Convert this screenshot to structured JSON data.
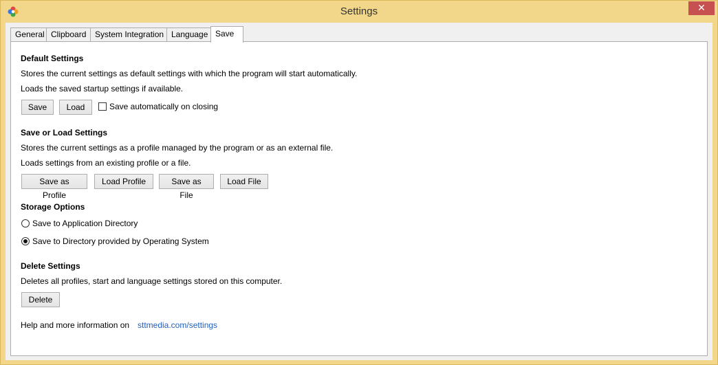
{
  "window": {
    "title": "Settings",
    "close_glyph": "✕"
  },
  "tabs": [
    {
      "label": "General"
    },
    {
      "label": "Clipboard"
    },
    {
      "label": "System Integration"
    },
    {
      "label": "Language"
    },
    {
      "label": "Save",
      "active": true
    }
  ],
  "default_settings": {
    "heading": "Default Settings",
    "line1": "Stores the current settings as default settings with which the program will start automatically.",
    "line2": "Loads the saved startup settings if available.",
    "save_label": "Save",
    "load_label": "Load",
    "auto_save_label": "Save automatically on closing",
    "auto_save_checked": false
  },
  "save_load": {
    "heading": "Save or Load Settings",
    "line1": "Stores the current settings as a profile managed by the program or as an external file.",
    "line2": "Loads settings from an existing profile or a file.",
    "save_profile_label": "Save as Profile",
    "load_profile_label": "Load Profile",
    "save_file_label": "Save as File",
    "load_file_label": "Load File"
  },
  "storage": {
    "heading": "Storage Options",
    "option1": "Save to Application Directory",
    "option2": "Save to Directory provided by Operating System",
    "selected": "option2"
  },
  "delete_settings": {
    "heading": "Delete Settings",
    "line1": "Deletes all profiles, start and language settings stored on this computer.",
    "delete_label": "Delete"
  },
  "help": {
    "text": "Help and more information on",
    "link": "sttmedia.com/settings"
  },
  "colors": {
    "titlebar": "#f2d78a",
    "close_button": "#c75050",
    "link": "#1f5fbf"
  }
}
